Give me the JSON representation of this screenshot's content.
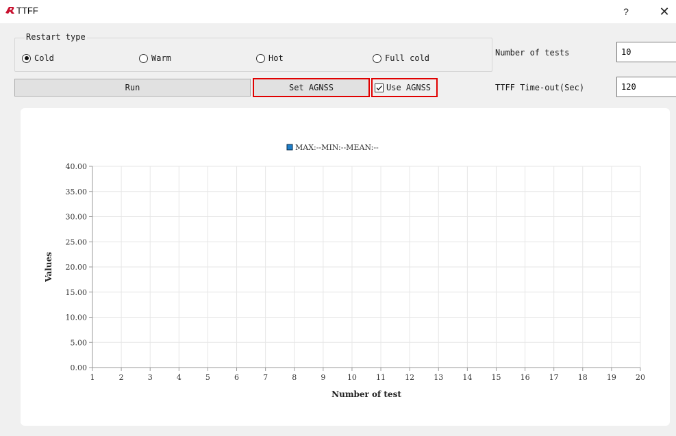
{
  "window": {
    "title": "TTFF",
    "help_label": "?",
    "close_label": "✕"
  },
  "restart_type": {
    "title": "Restart type",
    "options": [
      {
        "label": "Cold",
        "checked": true
      },
      {
        "label": "Warm",
        "checked": false
      },
      {
        "label": "Hot",
        "checked": false
      },
      {
        "label": "Full cold",
        "checked": false
      }
    ]
  },
  "buttons": {
    "run": "Run",
    "set_agnss": "Set AGNSS"
  },
  "use_agnss": {
    "label": "Use AGNSS",
    "checked": true
  },
  "settings": {
    "num_tests_label": "Number of  tests",
    "num_tests_value": "10",
    "timeout_label": "TTFF Time-out(Sec)",
    "timeout_value": "120"
  },
  "colors": {
    "highlight": "#e00000",
    "legend_marker": "#1f7fc9",
    "grid": "#e6e6e6"
  },
  "chart_data": {
    "type": "line",
    "legend": [
      "MAX:--MIN:--MEAN:--"
    ],
    "xlabel": "Number of test",
    "ylabel": "Values",
    "x_ticks": [
      "1",
      "2",
      "3",
      "4",
      "5",
      "6",
      "7",
      "8",
      "9",
      "10",
      "11",
      "12",
      "13",
      "14",
      "15",
      "16",
      "17",
      "18",
      "19",
      "20"
    ],
    "y_ticks": [
      "0.00",
      "5.00",
      "10.00",
      "15.00",
      "20.00",
      "25.00",
      "30.00",
      "35.00",
      "40.00"
    ],
    "xlim": [
      1,
      20
    ],
    "ylim": [
      0,
      40
    ],
    "grid": true,
    "series": [
      {
        "values": []
      }
    ]
  }
}
